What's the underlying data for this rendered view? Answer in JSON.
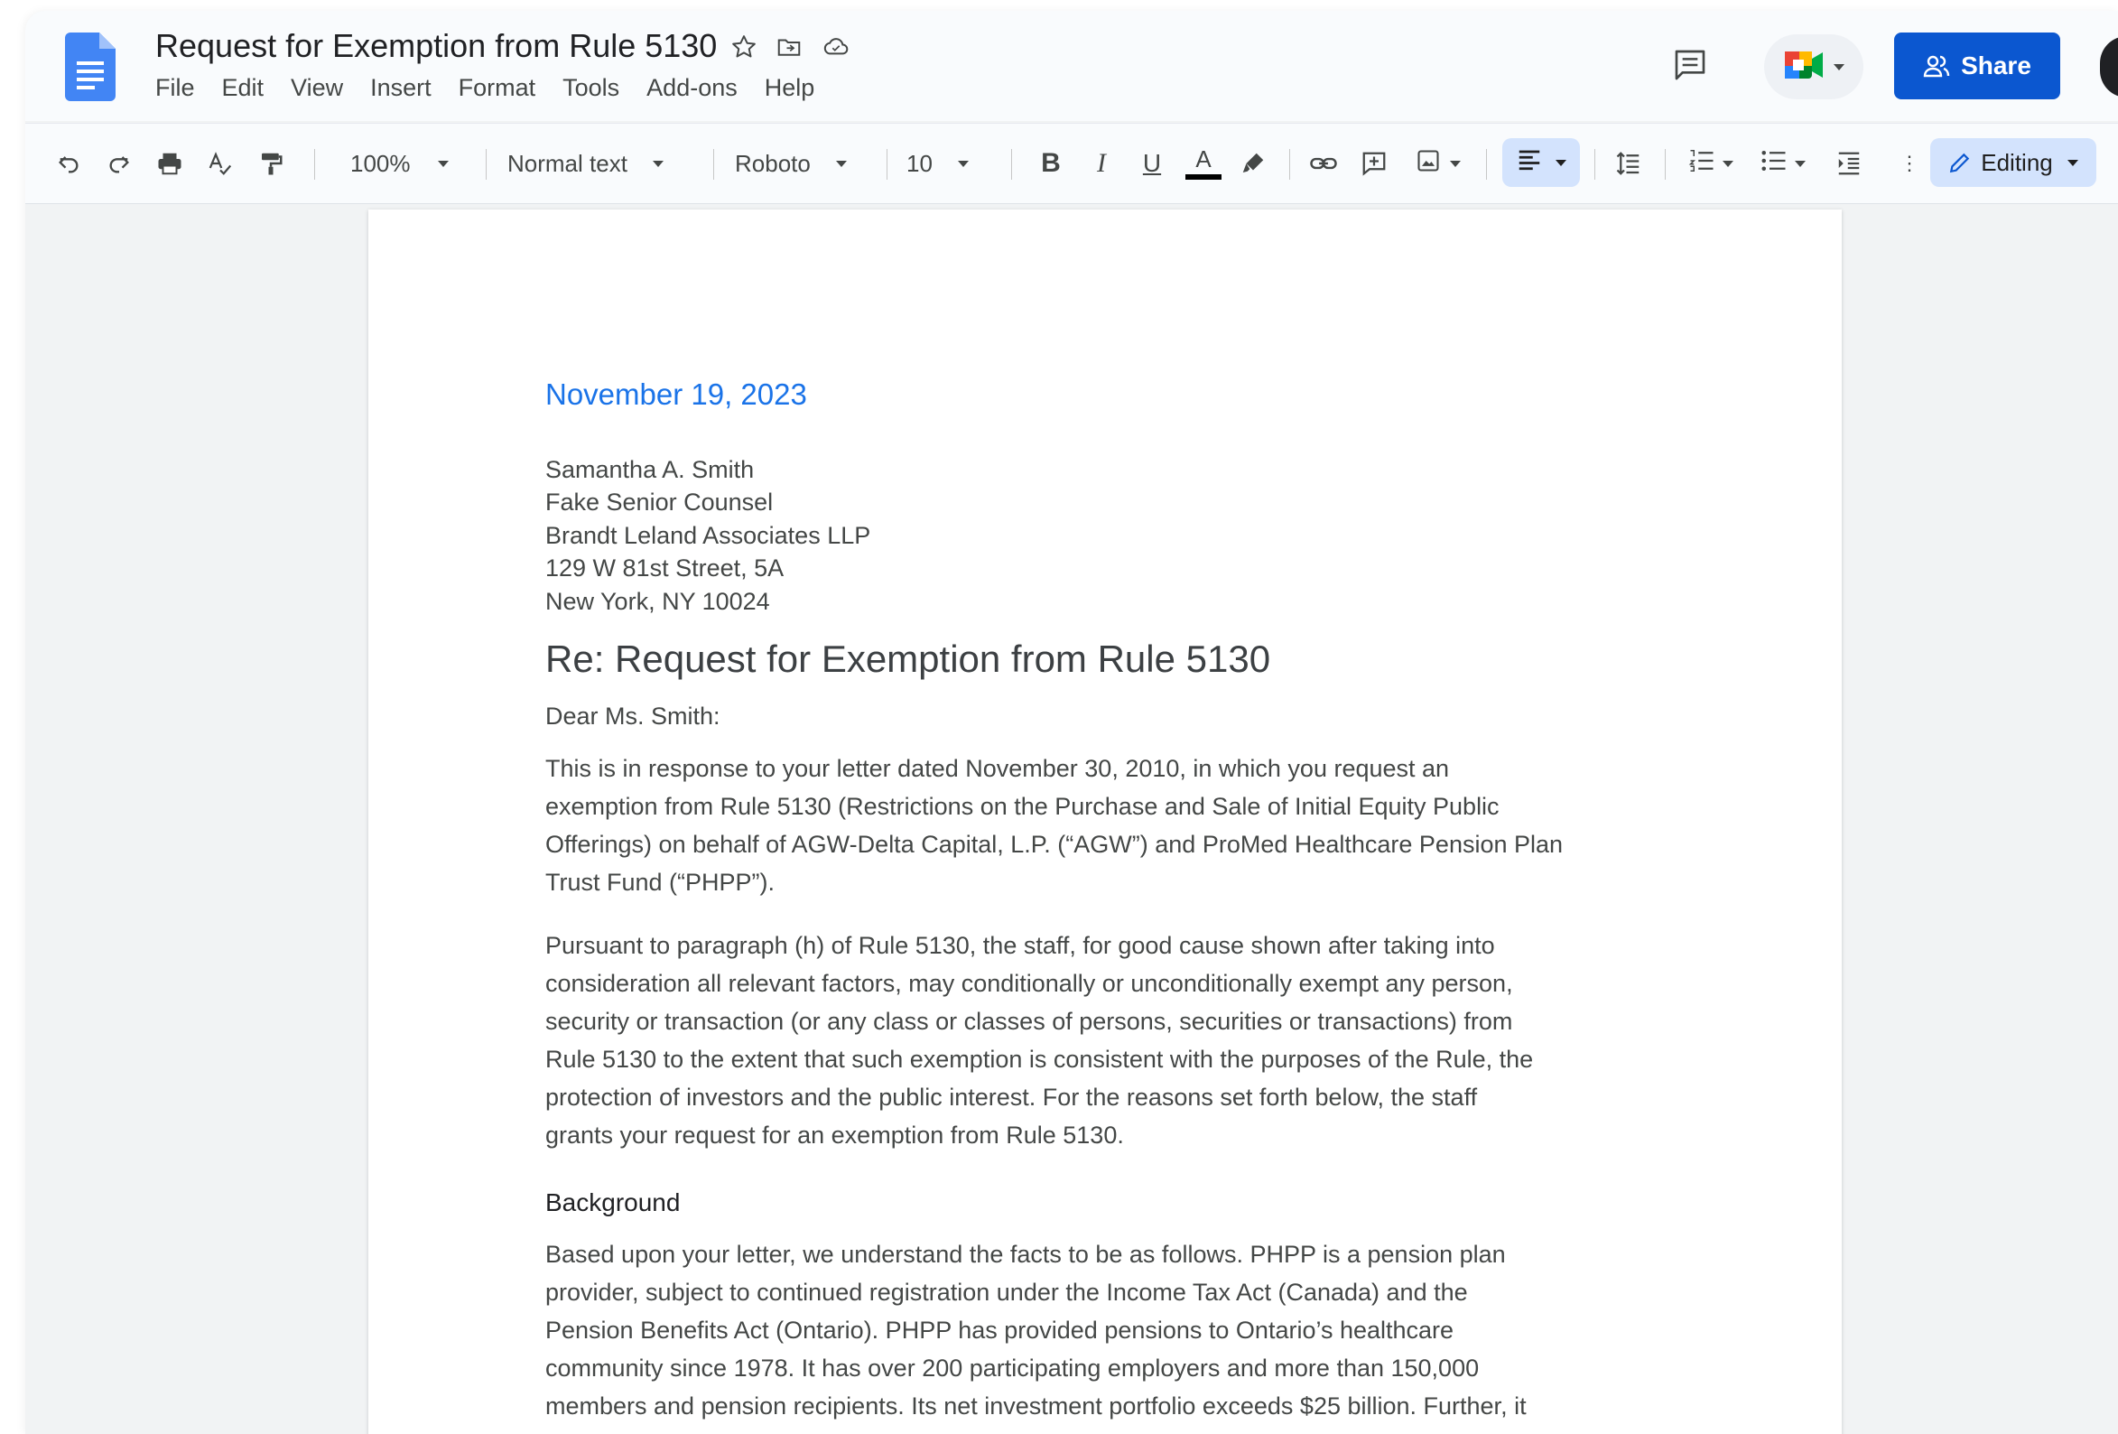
{
  "app": {
    "doc_title": "Request for Exemption from Rule 5130",
    "menu": [
      "File",
      "Edit",
      "View",
      "Insert",
      "Format",
      "Tools",
      "Add-ons",
      "Help"
    ],
    "share_label": "Share"
  },
  "toolbar": {
    "zoom": "100%",
    "style": "Normal text",
    "font": "Roboto",
    "font_size": "10",
    "mode": "Editing"
  },
  "icons": [
    "docs-logo",
    "star-icon",
    "move-folder-icon",
    "cloud-status-icon",
    "comment-history-icon",
    "meet-icon",
    "share-people-icon",
    "undo-icon",
    "redo-icon",
    "print-icon",
    "spellcheck-icon",
    "paint-format-icon",
    "bold-icon",
    "italic-icon",
    "underline-icon",
    "text-color-icon",
    "highlight-icon",
    "link-icon",
    "add-comment-icon",
    "insert-image-icon",
    "align-left-icon",
    "line-spacing-icon",
    "numbered-list-icon",
    "bulleted-list-icon",
    "indent-icon",
    "pencil-icon"
  ],
  "colors": {
    "accent": "#0b57d0",
    "date_text": "#1a73e8",
    "selected_button": "#d3e3fd"
  },
  "document": {
    "date": "November 19, 2023",
    "address": [
      "Samantha A. Smith",
      "Fake Senior Counsel",
      "Brandt Leland Associates LLP",
      "129 W 81st Street, 5A",
      "New York, NY 10024"
    ],
    "re_heading": "Re: Request for Exemption from Rule 5130",
    "salutation": "Dear Ms. Smith:",
    "paragraph1_lines": [
      "This is in response to your letter dated November 30, 2010, in which you request an",
      "exemption from Rule 5130 (Restrictions on the Purchase and Sale of Initial Equity Public",
      "Offerings) on behalf of AGW-Delta Capital, L.P. (“AGW”) and ProMed Healthcare Pension Plan",
      "Trust Fund (“PHPP”)."
    ],
    "paragraph2_lines": [
      "Pursuant to paragraph (h) of Rule 5130, the staff, for good cause shown after taking into",
      "consideration all relevant factors, may conditionally or unconditionally exempt any person,",
      "security or transaction (or any class or classes of persons, securities or transactions) from",
      "Rule 5130 to the extent that such exemption is consistent with the purposes of the Rule, the",
      "protection of investors and the public interest. For the reasons set forth below, the staff",
      "grants your request for an exemption from Rule 5130."
    ],
    "background_heading": "Background",
    "paragraph3_lines": [
      "Based upon your letter, we understand the facts to be as follows. PHPP is a pension plan",
      "provider, subject to continued registration under the Income Tax Act (Canada) and the",
      "Pension Benefits Act (Ontario). PHPP has provided pensions to Ontario’s healthcare",
      "community since 1978. It has over 200 participating employers and more than 150,000",
      "members and pension recipients. Its net investment portfolio exceeds $25 billion. Further, it"
    ]
  }
}
